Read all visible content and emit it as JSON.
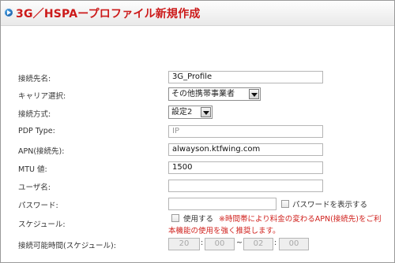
{
  "title": "3G／HSPAープロファイル新規作成",
  "form": {
    "connection_name": {
      "label": "接続先名:",
      "value": "3G_Profile"
    },
    "carrier": {
      "label": "キャリア選択:",
      "selected": "その他携帯事業者"
    },
    "connect_method": {
      "label": "接続方式:",
      "selected": "設定2"
    },
    "pdp_type": {
      "label": "PDP Type:",
      "value": "IP"
    },
    "apn": {
      "label": "APN(接続先):",
      "value": "alwayson.ktfwing.com"
    },
    "mtu": {
      "label": "MTU 値:",
      "value": "1500"
    },
    "username": {
      "label": "ユーザ名:",
      "value": ""
    },
    "password": {
      "label": "パスワード:",
      "value": "",
      "show_label": "パスワードを表示する"
    },
    "schedule": {
      "label": "スケジュール:",
      "use_label": "使用する",
      "warning_line1": "※時間帯により料金の変わるAPN(接続先)をご利",
      "warning_line2": "本機能の使用を強く推奨します。"
    },
    "connect_time": {
      "label": "接続可能時間(スケジュール):",
      "start_hour": "20",
      "start_min": "00",
      "end_hour": "02",
      "end_min": "00",
      "colon": ":",
      "tilde": "~"
    }
  }
}
